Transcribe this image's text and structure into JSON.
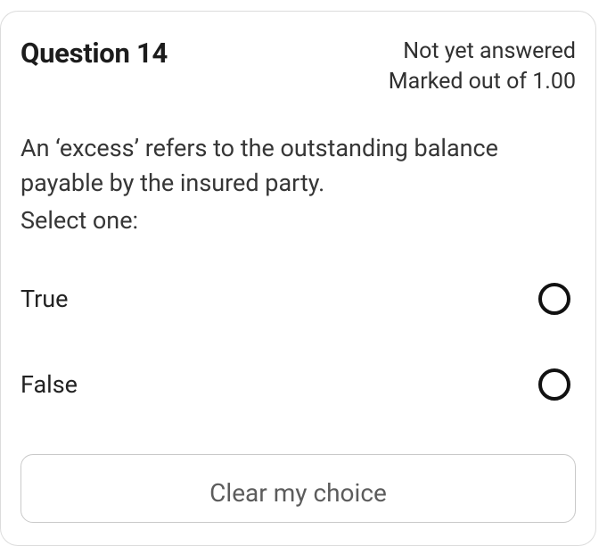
{
  "header": {
    "question_label": "Question 14",
    "status_line1": "Not yet answered",
    "status_line2": "Marked out of 1.00"
  },
  "body": {
    "stem": "An ‘excess’ refers to the outstanding balance payable by the insured party.",
    "select_prompt": "Select one:"
  },
  "options": [
    {
      "label": "True",
      "selected": false
    },
    {
      "label": "False",
      "selected": false
    }
  ],
  "actions": {
    "clear_label": "Clear my choice"
  }
}
